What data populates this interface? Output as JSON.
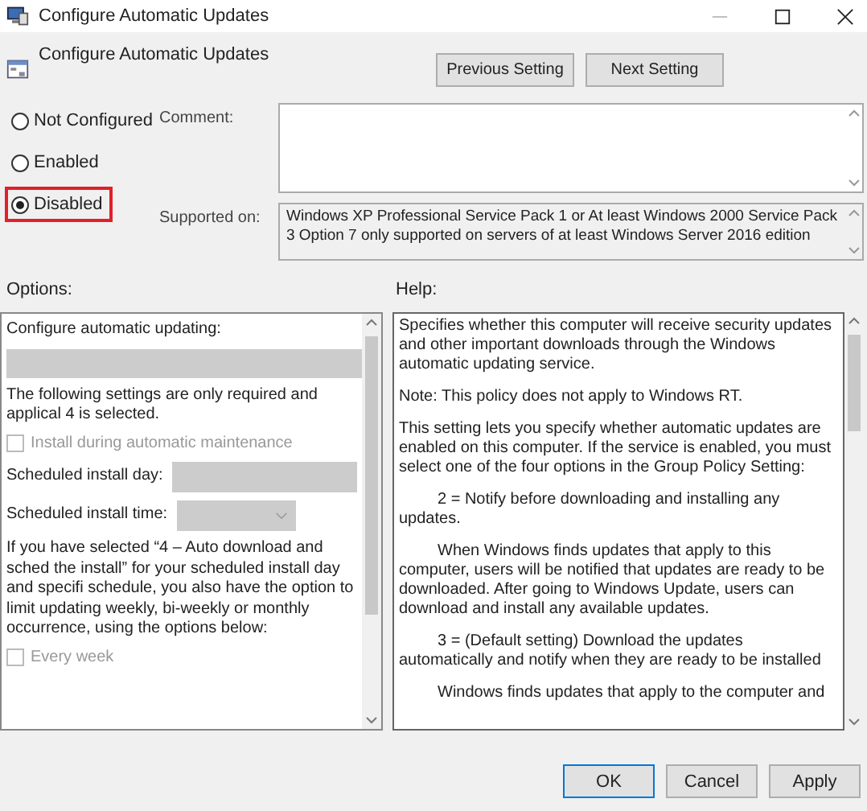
{
  "window": {
    "title": "Configure Automatic Updates"
  },
  "header": {
    "title": "Configure Automatic Updates",
    "buttons": [
      {
        "label": "Previous Setting"
      },
      {
        "label": "Next Setting"
      }
    ]
  },
  "states": [
    {
      "label": "Not Configured",
      "selected": false,
      "highlighted": false
    },
    {
      "label": "Enabled",
      "selected": false,
      "highlighted": false
    },
    {
      "label": "Disabled",
      "selected": true,
      "highlighted": true
    }
  ],
  "comment": {
    "label": "Comment:"
  },
  "supported_on": {
    "label": "Supported on:",
    "text": "Windows XP Professional Service Pack 1 or At least Windows 2000 Service Pack 3 Option 7 only supported on servers of at least Windows Server 2016 edition"
  },
  "options": {
    "label": "Options:",
    "items": [
      {
        "kind": "heading",
        "text": "Configure automatic updating:"
      },
      {
        "kind": "dropdown",
        "disabled": true
      },
      {
        "kind": "text",
        "text": "The following settings are only required and applical 4 is selected."
      },
      {
        "kind": "checkbox",
        "label": "Install during automatic maintenance",
        "checked": false,
        "disabled": true
      },
      {
        "kind": "field",
        "label": "Scheduled install day:",
        "disabled": true
      },
      {
        "kind": "combo",
        "label": "Scheduled install time:",
        "disabled": true
      },
      {
        "kind": "text",
        "text": "If you have selected “4 – Auto download and sched the install” for your scheduled install day and specifi schedule, you also have the option to limit updating weekly, bi-weekly or monthly occurrence, using the options below:"
      },
      {
        "kind": "checkbox",
        "label": "Every week",
        "checked": false,
        "disabled": true
      }
    ]
  },
  "help": {
    "label": "Help:",
    "paragraphs": [
      {
        "text": "Specifies whether this computer will receive security updates and other important downloads through the Windows automatic updating service.",
        "indent": false
      },
      {
        "text": "Note: This policy does not apply to Windows RT.",
        "indent": false
      },
      {
        "text": "This setting lets you specify whether automatic updates are enabled on this computer. If the service is enabled, you must select one of the four options in the Group Policy Setting:",
        "indent": false
      },
      {
        "text": "2 = Notify before downloading and installing any updates.",
        "indent": true
      },
      {
        "text": "When Windows finds updates that apply to this computer, users will be notified that updates are ready to be downloaded. After going to Windows Update, users can download and install any available updates.",
        "indent": true
      },
      {
        "text": "3 = (Default setting) Download the updates automatically and notify when they are ready to be installed",
        "indent": true
      },
      {
        "text": "Windows finds updates that apply to the computer and",
        "indent": true
      }
    ]
  },
  "footer": {
    "buttons": [
      {
        "label": "OK",
        "default": true
      },
      {
        "label": "Cancel",
        "default": false
      },
      {
        "label": "Apply",
        "default": false
      }
    ]
  }
}
